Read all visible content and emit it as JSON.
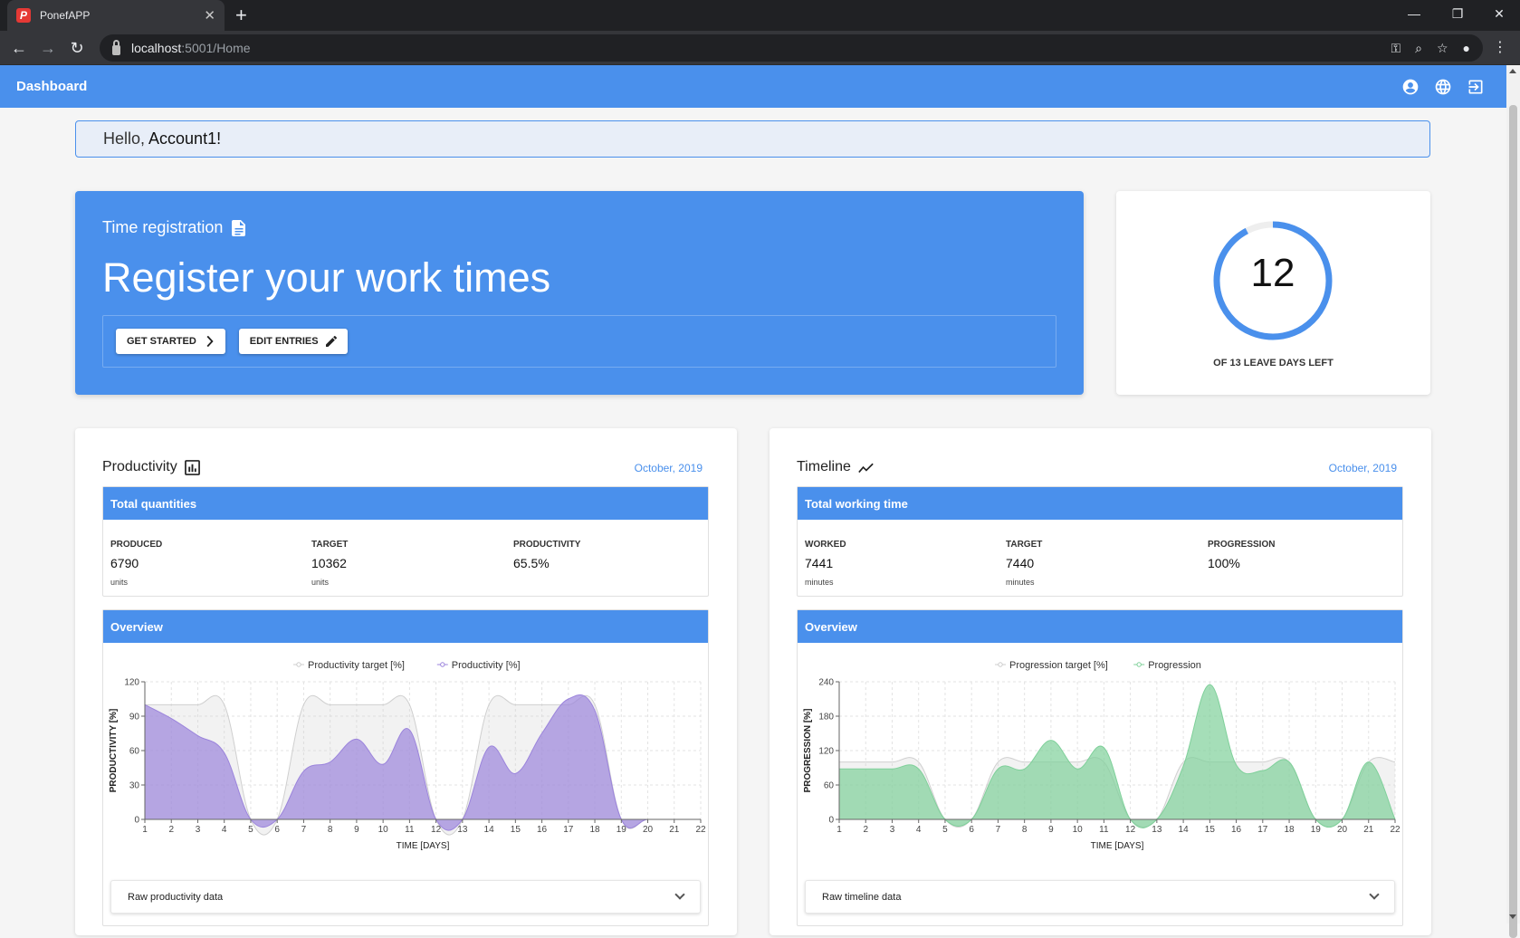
{
  "browser": {
    "tab_title": "PonefAPP",
    "favicon_letter": "P",
    "url_host": "localhost",
    "url_path": ":5001/Home"
  },
  "app": {
    "title": "Dashboard",
    "icons": [
      "account-icon",
      "globe-icon",
      "logout-icon"
    ]
  },
  "greeting": {
    "prefix": "Hello,",
    "name": "Account1!"
  },
  "hero": {
    "subtitle": "Time registration",
    "title": "Register your work times",
    "get_started": "GET STARTED",
    "edit_entries": "EDIT ENTRIES"
  },
  "leave": {
    "days_left": "12",
    "total_days": 13,
    "label": "OF 13 LEAVE DAYS LEFT",
    "accent": "#4a90ec"
  },
  "productivity": {
    "title": "Productivity",
    "date": "October, 2019",
    "box_title": "Total quantities",
    "stats": [
      {
        "label": "PRODUCED",
        "value": "6790",
        "unit": "units"
      },
      {
        "label": "TARGET",
        "value": "10362",
        "unit": "units"
      },
      {
        "label": "PRODUCTIVITY",
        "value": "65.5%",
        "unit": ""
      }
    ],
    "overview_title": "Overview",
    "raw_label": "Raw productivity data"
  },
  "timeline": {
    "title": "Timeline",
    "date": "October, 2019",
    "box_title": "Total working time",
    "stats": [
      {
        "label": "WORKED",
        "value": "7441",
        "unit": "minutes"
      },
      {
        "label": "TARGET",
        "value": "7440",
        "unit": "minutes"
      },
      {
        "label": "PROGRESSION",
        "value": "100%",
        "unit": ""
      }
    ],
    "overview_title": "Overview",
    "raw_label": "Raw timeline data"
  },
  "chart_data": [
    {
      "type": "area",
      "x": [
        1,
        2,
        3,
        4,
        5,
        6,
        7,
        8,
        9,
        10,
        11,
        12,
        13,
        14,
        15,
        16,
        17,
        18,
        19,
        20,
        21,
        22
      ],
      "series": [
        {
          "name": "Productivity target [%]",
          "color": "#cccccc",
          "values": [
            100,
            100,
            100,
            100,
            0,
            0,
            100,
            100,
            100,
            100,
            100,
            0,
            0,
            100,
            100,
            100,
            100,
            100,
            0,
            0,
            0,
            0
          ]
        },
        {
          "name": "Productivity [%]",
          "color": "#9b84dc",
          "values": [
            100,
            88,
            73,
            58,
            0,
            0,
            42,
            50,
            70,
            48,
            78,
            0,
            0,
            63,
            40,
            75,
            105,
            95,
            0,
            0,
            0,
            0
          ]
        }
      ],
      "xlabel": "TIME [DAYS]",
      "ylabel": "PRODUCTIVITY [%]",
      "ylim": [
        0,
        120
      ],
      "yticks": [
        0,
        30,
        60,
        90,
        120
      ],
      "grid": true,
      "legend": "top"
    },
    {
      "type": "area",
      "x": [
        1,
        2,
        3,
        4,
        5,
        6,
        7,
        8,
        9,
        10,
        11,
        12,
        13,
        14,
        15,
        16,
        17,
        18,
        19,
        20,
        21,
        22
      ],
      "series": [
        {
          "name": "Progression target [%]",
          "color": "#cccccc",
          "values": [
            100,
            100,
            100,
            100,
            0,
            0,
            100,
            100,
            100,
            100,
            100,
            0,
            0,
            100,
            100,
            100,
            100,
            100,
            0,
            0,
            100,
            100
          ]
        },
        {
          "name": "Progression",
          "color": "#7fd09a",
          "values": [
            88,
            88,
            88,
            88,
            0,
            0,
            88,
            88,
            138,
            88,
            125,
            0,
            0,
            93,
            235,
            95,
            85,
            100,
            0,
            0,
            100,
            0
          ]
        }
      ],
      "xlabel": "TIME [DAYS]",
      "ylabel": "PROGRESSION [%]",
      "ylim": [
        0,
        240
      ],
      "yticks": [
        0,
        60,
        120,
        180,
        240
      ],
      "grid": true,
      "legend": "top"
    }
  ]
}
